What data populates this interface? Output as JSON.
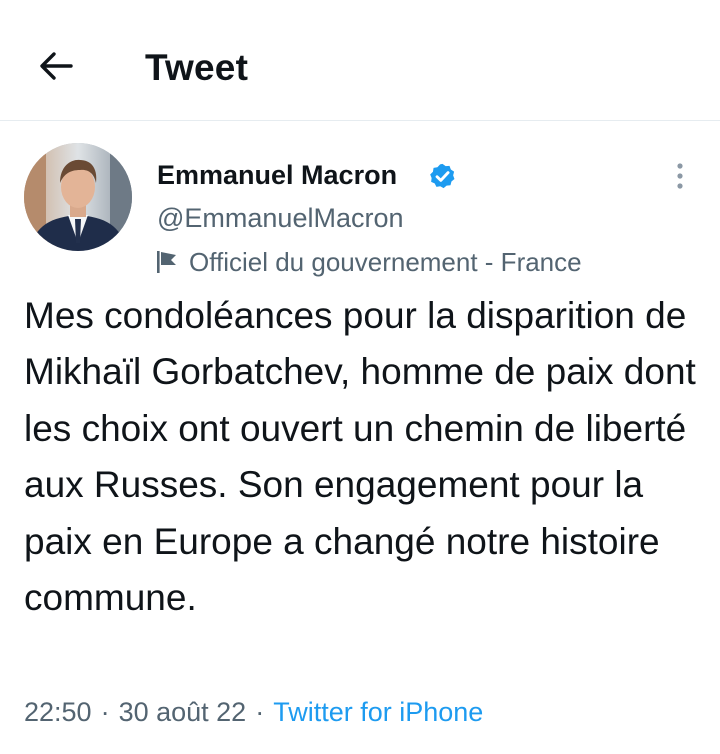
{
  "header": {
    "title": "Tweet",
    "back_icon": "arrow-left-icon"
  },
  "tweet": {
    "author": {
      "display_name": "Emmanuel Macron",
      "handle": "@EmmanuelMacron",
      "verified": true,
      "verified_icon": "verified-badge-icon",
      "label_icon": "flag-icon",
      "label": "Officiel du gouvernement - France"
    },
    "more_icon": "more-vertical-icon",
    "text": "Mes condoléances pour la disparition de Mikhaïl Gorbatchev, homme de paix dont les choix ont ouvert un chemin de liberté aux Russes. Son engagement pour la paix en Europe a changé notre histoire commune.",
    "time": "22:50",
    "separator": "·",
    "date": "30 août 22",
    "source": "Twitter for iPhone"
  },
  "colors": {
    "text": "#0f1419",
    "secondary": "#536471",
    "accent": "#1d9bf0",
    "divider": "#e6ecf0"
  }
}
